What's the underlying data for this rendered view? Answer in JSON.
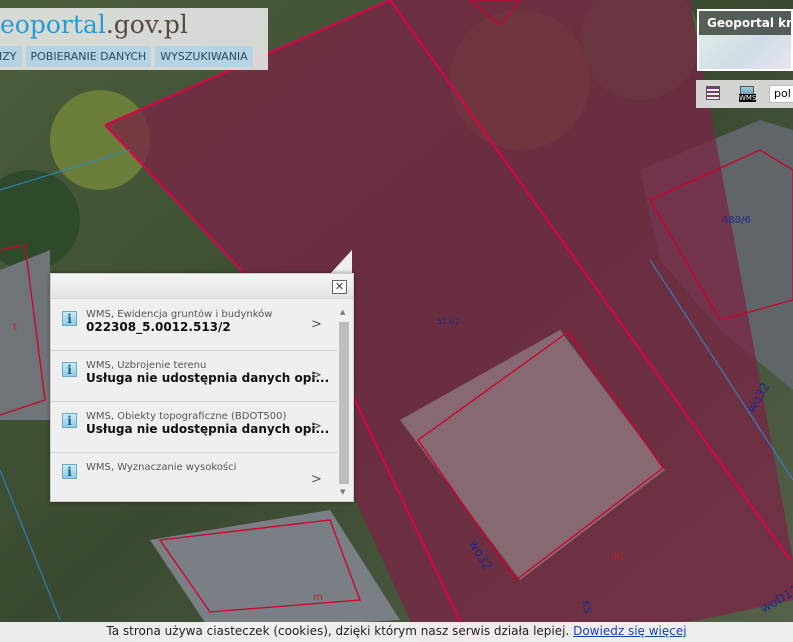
{
  "header": {
    "logo_prefix": "eo",
    "logo_blue": "portal",
    "logo_suffix": ".gov.pl",
    "nav": [
      "IZY",
      "POBIERANIE DANYCH",
      "WYSZUKIWANIA"
    ]
  },
  "minimap": {
    "title": "Geoportal kraj"
  },
  "tools": {
    "legend_icon": "legend-icon",
    "wms_icon": "wms-icon",
    "wms_label": "WMS",
    "language": "pol"
  },
  "map_labels": {
    "parcel_1": "480/6",
    "parcel_2": "513/2",
    "road_1": "wo32",
    "road_2": "wo32",
    "road_3": "woD12",
    "ks": "KS",
    "kl": "Kl",
    "m": "m",
    "t": "t"
  },
  "popup": {
    "items": [
      {
        "source": "WMS, Ewidencja gruntów i budynków",
        "value": "022308_5.0012.513/2"
      },
      {
        "source": "WMS, Uzbrojenie terenu",
        "value": "Usługa nie udostępnia danych opi..."
      },
      {
        "source": "WMS, Obiekty topograficzne (BDOT500)",
        "value": "Usługa nie udostępnia danych opi..."
      },
      {
        "source": "WMS, Wyznaczanie wysokości",
        "value": ""
      }
    ]
  },
  "cookie": {
    "text": "Ta strona używa ciasteczek (cookies), dzięki którym nasz serwis działa lepiej. ",
    "link": "Dowiedz się więcej"
  },
  "colors": {
    "parcel_line": "#e0004a",
    "highlight": "#8a1f4a",
    "accent": "#2a9ad4"
  }
}
